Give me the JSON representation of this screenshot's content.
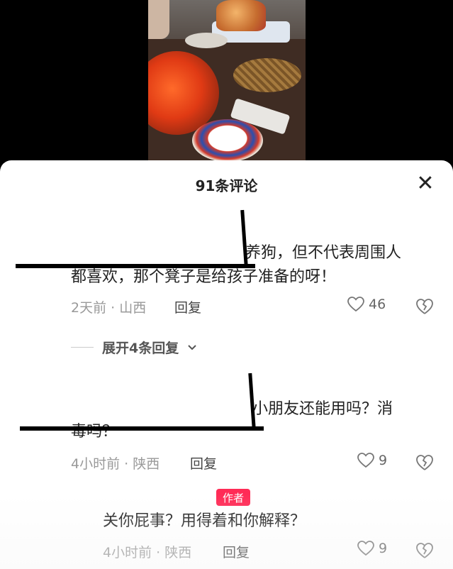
{
  "sheet": {
    "title": "91条评论",
    "close_label": "✕"
  },
  "comments": [
    {
      "line1": "养狗，但不代表周围人",
      "line2": "都喜欢，那个凳子是给孩子准备的呀！",
      "time_location": "2天前 · 山西",
      "reply": "回复",
      "likes": "46"
    },
    {
      "line1": "小朋友还能用吗？消",
      "line2": "毒吗？",
      "time_location": "4小时前 · 陕西",
      "reply": "回复",
      "likes": "9"
    },
    {
      "badge": "作者",
      "line1": "关你屁事？用得着和你解释？",
      "time_location": "4小时前 · 陕西",
      "reply": "回复",
      "likes": "9"
    }
  ],
  "expand_replies": "展开4条回复",
  "colors": {
    "badge": "#ff2b56",
    "meta": "#999999",
    "redaction": "#000000"
  }
}
